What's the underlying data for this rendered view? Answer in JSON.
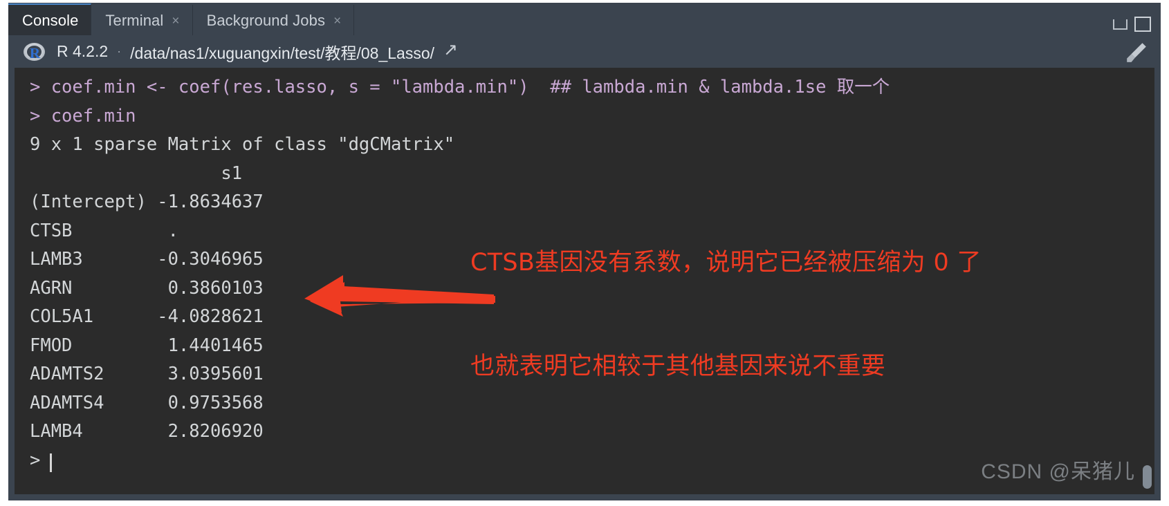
{
  "window": {
    "minimize_icon": "window-minimize-icon",
    "maximize_icon": "window-maximize-icon"
  },
  "tabs": [
    {
      "label": "Console",
      "closable": false,
      "active": true
    },
    {
      "label": "Terminal",
      "closable": true,
      "close_glyph": "×",
      "active": false
    },
    {
      "label": "Background Jobs",
      "closable": true,
      "close_glyph": "×",
      "active": false
    }
  ],
  "pathbar": {
    "logo_letter": "R",
    "version": "R 4.2.2",
    "separator": "·",
    "path": "/data/nas1/xuguangxin/test/教程/08_Lasso/",
    "share_glyph": "↗",
    "brush_icon": "broom-icon"
  },
  "console": {
    "lines": [
      {
        "kind": "cmd",
        "text": "> coef.min <- coef(res.lasso, s = \"lambda.min\")  ## lambda.min & lambda.1se 取一个"
      },
      {
        "kind": "cmd",
        "text": "> coef.min"
      },
      {
        "kind": "out",
        "text": "9 x 1 sparse Matrix of class \"dgCMatrix\""
      },
      {
        "kind": "out",
        "text": "                  s1"
      },
      {
        "kind": "out",
        "text": "(Intercept) -1.8634637"
      },
      {
        "kind": "out",
        "text": "CTSB         .        "
      },
      {
        "kind": "out",
        "text": "LAMB3       -0.3046965"
      },
      {
        "kind": "out",
        "text": "AGRN         0.3860103"
      },
      {
        "kind": "out",
        "text": "COL5A1      -4.0828621"
      },
      {
        "kind": "out",
        "text": "FMOD         1.4401465"
      },
      {
        "kind": "out",
        "text": "ADAMTS2      3.0395601"
      },
      {
        "kind": "out",
        "text": "ADAMTS4      0.9753568"
      },
      {
        "kind": "out",
        "text": "LAMB4        2.8206920"
      }
    ],
    "prompt": ">"
  },
  "matrix_output": {
    "header": "9 x 1 sparse Matrix of class \"dgCMatrix\"",
    "column": "s1",
    "rows": [
      {
        "name": "(Intercept)",
        "value": "-1.8634637"
      },
      {
        "name": "CTSB",
        "value": "."
      },
      {
        "name": "LAMB3",
        "value": "-0.3046965"
      },
      {
        "name": "AGRN",
        "value": "0.3860103"
      },
      {
        "name": "COL5A1",
        "value": "-4.0828621"
      },
      {
        "name": "FMOD",
        "value": "1.4401465"
      },
      {
        "name": "ADAMTS2",
        "value": "3.0395601"
      },
      {
        "name": "ADAMTS4",
        "value": "0.9753568"
      },
      {
        "name": "LAMB4",
        "value": "2.8206920"
      }
    ]
  },
  "annotation": {
    "line1": "CTSB基因没有系数，说明它已经被压缩为 0 了",
    "line2": "也就表明它相较于其他基因来说不重要",
    "color": "#ef3b22",
    "arrow": "left-arrow-annotation"
  },
  "watermark": {
    "text": "CSDN @呆猪儿"
  },
  "colors": {
    "chrome": "#3b444f",
    "console_bg": "#2b2b2b",
    "active_tab_bg": "#2e3339",
    "accent": "#4a86c8",
    "command_text": "#c9a8d4",
    "output_text": "#d3d6d8",
    "annotation_red": "#ef3b22"
  }
}
